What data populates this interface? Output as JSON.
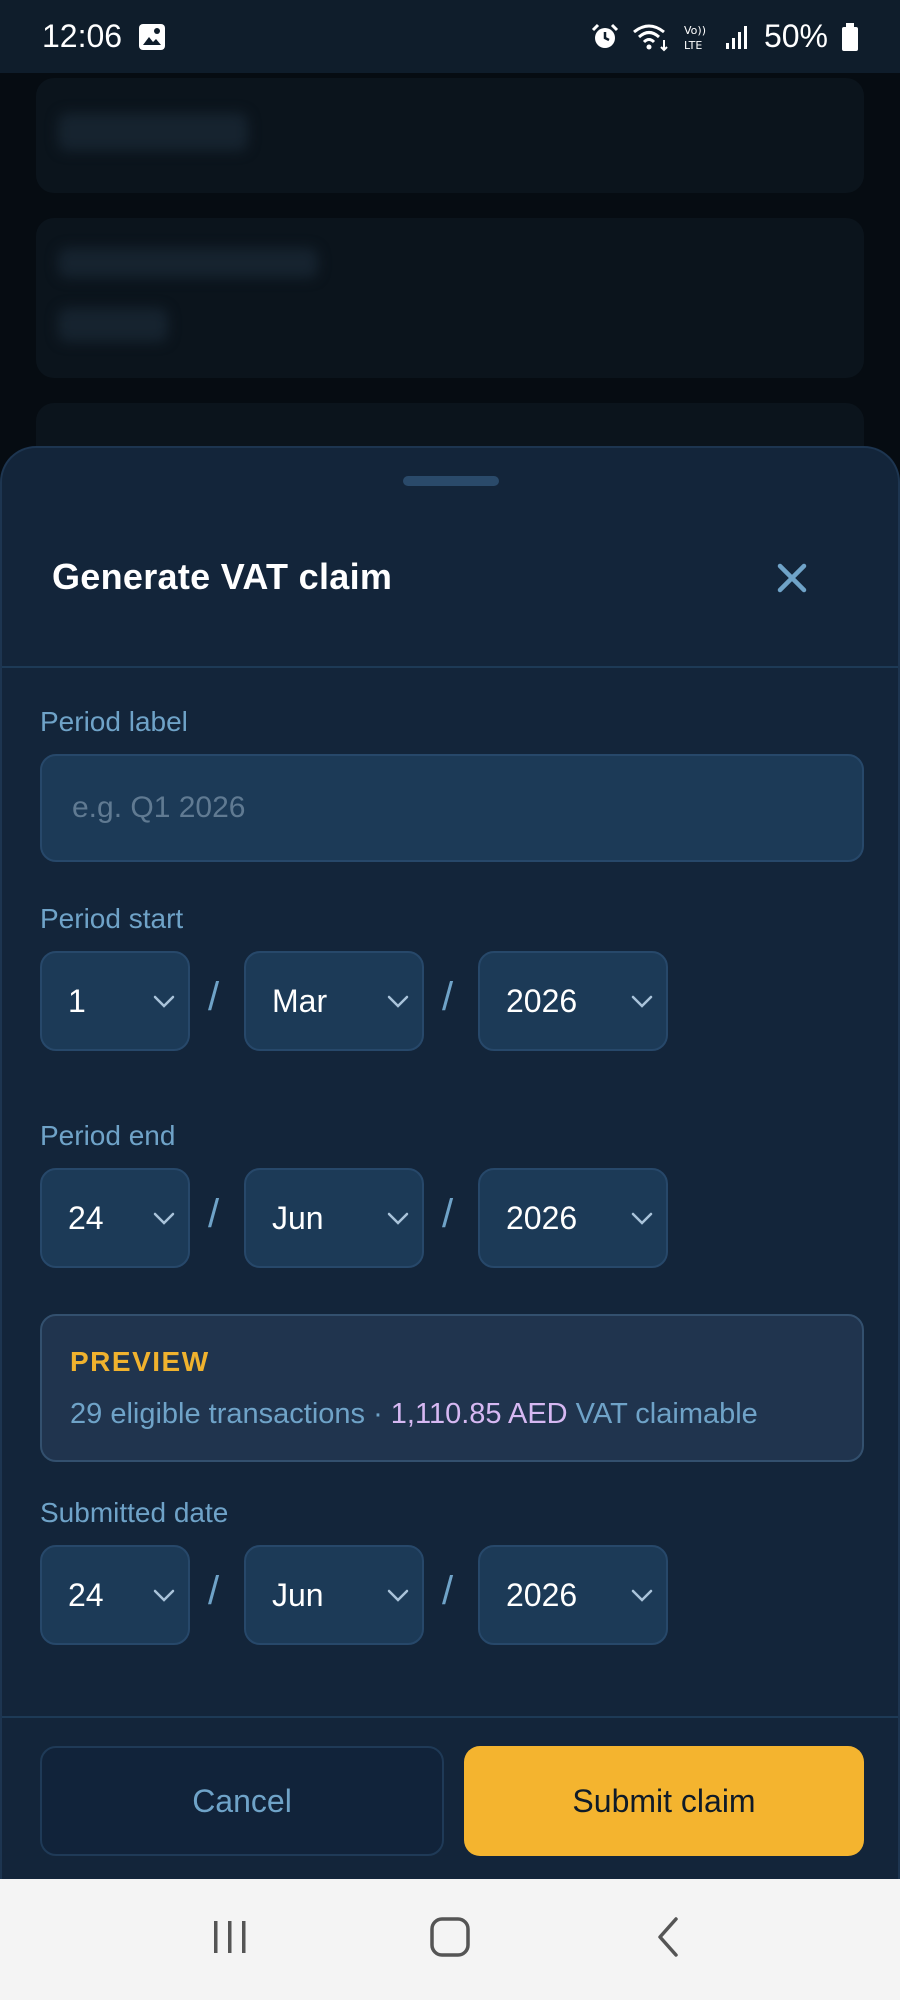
{
  "status_bar": {
    "time": "12:06",
    "battery": "50%",
    "icons": [
      "image-icon",
      "alarm-icon",
      "wifi-icon",
      "volte-icon",
      "signal-icon",
      "battery-icon"
    ]
  },
  "sheet": {
    "title": "Generate VAT claim",
    "close_icon": "close-icon"
  },
  "form": {
    "period_label": {
      "label": "Period label",
      "value": "",
      "placeholder": "e.g. Q1 2026"
    },
    "period_start": {
      "label": "Period start",
      "day": "1",
      "month": "Mar",
      "year": "2026"
    },
    "period_end": {
      "label": "Period end",
      "day": "24",
      "month": "Jun",
      "year": "2026"
    },
    "submitted_date": {
      "label": "Submitted date",
      "day": "24",
      "month": "Jun",
      "year": "2026"
    },
    "separator": "/"
  },
  "preview": {
    "title": "PREVIEW",
    "transactions_text": "29 eligible transactions · ",
    "amount_text": "1,110.85 AED",
    "suffix_text": " VAT claimable"
  },
  "actions": {
    "cancel_label": "Cancel",
    "submit_label": "Submit claim"
  },
  "colors": {
    "accent": "#f4b42f",
    "sheet_background": "#13253a",
    "label": "#6fa3c8",
    "amount": "#d6b8f2"
  },
  "nav_bar": {
    "icons": [
      "recent-apps-icon",
      "home-icon",
      "back-icon"
    ]
  }
}
